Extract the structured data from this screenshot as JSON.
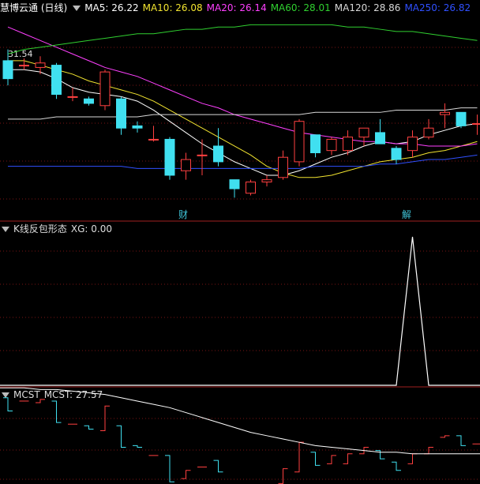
{
  "header": {
    "title": "慧博云通 (日线)",
    "ma": [
      {
        "label": "MA5: 26.22",
        "color": "#ffffff"
      },
      {
        "label": "MA10: 26.08",
        "color": "#f2e430"
      },
      {
        "label": "MA20: 26.14",
        "color": "#ff40ff"
      },
      {
        "label": "MA60: 28.01",
        "color": "#30d030"
      },
      {
        "label": "MA120: 28.86",
        "color": "#d8d8d8"
      },
      {
        "label": "MA250: 26.82",
        "color": "#3050ff"
      }
    ]
  },
  "price_marker": "31.54",
  "event_tags": [
    "财",
    "解"
  ],
  "indicator_panel": {
    "title": "K线反包形态",
    "value_label": "XG: 0.00"
  },
  "mcst_panel": {
    "title": "MCST",
    "value_label": "MCST: 27.57"
  },
  "colors": {
    "up": "#ff4040",
    "down": "#40e0f0",
    "grid": "#7a1515",
    "border": "#a02020"
  },
  "chart_data": [
    {
      "type": "candlestick",
      "title": "慧博云通 (日线)",
      "candles": [
        {
          "o": 31.0,
          "h": 31.5,
          "l": 29.9,
          "c": 30.2
        },
        {
          "o": 30.8,
          "h": 31.1,
          "l": 30.6,
          "c": 30.8
        },
        {
          "o": 30.7,
          "h": 31.2,
          "l": 30.4,
          "c": 30.9
        },
        {
          "o": 30.8,
          "h": 30.9,
          "l": 29.3,
          "c": 29.5
        },
        {
          "o": 29.4,
          "h": 29.8,
          "l": 29.2,
          "c": 29.4
        },
        {
          "o": 29.3,
          "h": 29.4,
          "l": 29.0,
          "c": 29.1
        },
        {
          "o": 29.0,
          "h": 30.6,
          "l": 28.8,
          "c": 30.5
        },
        {
          "o": 29.3,
          "h": 29.4,
          "l": 27.7,
          "c": 28.0
        },
        {
          "o": 28.1,
          "h": 28.3,
          "l": 27.8,
          "c": 28.0
        },
        {
          "o": 27.5,
          "h": 28.1,
          "l": 27.4,
          "c": 27.5
        },
        {
          "o": 27.5,
          "h": 27.6,
          "l": 25.7,
          "c": 25.9
        },
        {
          "o": 26.1,
          "h": 26.9,
          "l": 25.7,
          "c": 26.6
        },
        {
          "o": 26.8,
          "h": 27.5,
          "l": 25.9,
          "c": 26.8
        },
        {
          "o": 27.2,
          "h": 28.0,
          "l": 26.3,
          "c": 26.5
        },
        {
          "o": 25.7,
          "h": 25.7,
          "l": 24.9,
          "c": 25.3
        },
        {
          "o": 25.1,
          "h": 25.7,
          "l": 25.0,
          "c": 25.6
        },
        {
          "o": 25.6,
          "h": 25.9,
          "l": 25.4,
          "c": 25.7
        },
        {
          "o": 25.8,
          "h": 27.0,
          "l": 25.7,
          "c": 26.7
        },
        {
          "o": 26.5,
          "h": 28.4,
          "l": 26.3,
          "c": 28.3
        },
        {
          "o": 27.7,
          "h": 27.7,
          "l": 26.7,
          "c": 26.9
        },
        {
          "o": 27.0,
          "h": 27.6,
          "l": 26.8,
          "c": 27.5
        },
        {
          "o": 27.0,
          "h": 27.9,
          "l": 26.8,
          "c": 27.6
        },
        {
          "o": 27.6,
          "h": 28.0,
          "l": 27.2,
          "c": 28.0
        },
        {
          "o": 27.8,
          "h": 28.4,
          "l": 27.4,
          "c": 27.3
        },
        {
          "o": 27.1,
          "h": 27.2,
          "l": 26.4,
          "c": 26.6
        },
        {
          "o": 27.0,
          "h": 27.9,
          "l": 26.7,
          "c": 27.6
        },
        {
          "o": 27.6,
          "h": 28.4,
          "l": 27.5,
          "c": 28.0
        },
        {
          "o": 28.6,
          "h": 29.1,
          "l": 28.0,
          "c": 28.7
        },
        {
          "o": 28.7,
          "h": 28.7,
          "l": 28.0,
          "c": 28.1
        },
        {
          "o": 28.2,
          "h": 28.6,
          "l": 27.7,
          "c": 28.2
        }
      ],
      "ma": {
        "MA5": [
          30.6,
          30.6,
          30.5,
          30.2,
          29.8,
          29.6,
          29.5,
          29.4,
          29.2,
          28.8,
          28.3,
          27.8,
          27.3,
          26.9,
          26.5,
          26.2,
          25.9,
          25.9,
          26.1,
          26.4,
          26.7,
          26.9,
          27.2,
          27.4,
          27.3,
          27.4,
          27.7,
          27.9,
          28.1,
          28.2
        ],
        "MA10": [
          31.0,
          31.0,
          30.8,
          30.6,
          30.4,
          30.1,
          29.9,
          29.7,
          29.5,
          29.2,
          28.8,
          28.4,
          28.0,
          27.6,
          27.2,
          26.8,
          26.3,
          26.0,
          25.8,
          25.8,
          25.9,
          26.1,
          26.3,
          26.5,
          26.6,
          26.7,
          26.9,
          27.0,
          27.2,
          27.4
        ],
        "MA20": [
          32.5,
          32.2,
          31.9,
          31.6,
          31.3,
          31.0,
          30.7,
          30.5,
          30.3,
          30.0,
          29.7,
          29.4,
          29.1,
          28.9,
          28.6,
          28.4,
          28.2,
          28.0,
          27.8,
          27.7,
          27.6,
          27.5,
          27.4,
          27.4,
          27.3,
          27.3,
          27.2,
          27.2,
          27.2,
          27.3
        ],
        "MA60": [
          31.3,
          31.5,
          31.6,
          31.7,
          31.8,
          31.9,
          32.0,
          32.1,
          32.2,
          32.2,
          32.3,
          32.4,
          32.4,
          32.5,
          32.5,
          32.6,
          32.6,
          32.6,
          32.6,
          32.6,
          32.6,
          32.5,
          32.5,
          32.4,
          32.3,
          32.3,
          32.2,
          32.1,
          32.0,
          31.9
        ],
        "MA120": [
          28.4,
          28.4,
          28.4,
          28.5,
          28.5,
          28.5,
          28.5,
          28.5,
          28.5,
          28.6,
          28.6,
          28.6,
          28.6,
          28.6,
          28.6,
          28.6,
          28.6,
          28.6,
          28.6,
          28.7,
          28.7,
          28.7,
          28.7,
          28.7,
          28.8,
          28.8,
          28.8,
          28.8,
          28.9,
          28.9
        ],
        "MA250": [
          26.3,
          26.3,
          26.3,
          26.3,
          26.3,
          26.3,
          26.3,
          26.3,
          26.2,
          26.2,
          26.2,
          26.2,
          26.2,
          26.2,
          26.2,
          26.2,
          26.2,
          26.2,
          26.2,
          26.3,
          26.3,
          26.3,
          26.3,
          26.4,
          26.4,
          26.5,
          26.6,
          26.6,
          26.7,
          26.8
        ]
      },
      "ylim": [
        24,
        33
      ]
    },
    {
      "type": "line",
      "title": "K线反包形态",
      "series": [
        {
          "name": "XG",
          "values": [
            0,
            0,
            0,
            0,
            0,
            0,
            0,
            0,
            0,
            0,
            0,
            0,
            0,
            0,
            0,
            0,
            0,
            0,
            0,
            0,
            0,
            0,
            0,
            0,
            0,
            1,
            0,
            0,
            0,
            0
          ]
        }
      ],
      "ylim": [
        0,
        1
      ]
    },
    {
      "type": "line",
      "title": "MCST",
      "series": [
        {
          "name": "MCST",
          "values": [
            31.6,
            31.6,
            31.5,
            31.5,
            31.4,
            31.3,
            31.2,
            31.0,
            30.8,
            30.6,
            30.4,
            30.1,
            29.8,
            29.5,
            29.2,
            28.9,
            28.7,
            28.5,
            28.3,
            28.1,
            28.0,
            27.9,
            27.8,
            27.7,
            27.7,
            27.6,
            27.6,
            27.6,
            27.6,
            27.6
          ]
        }
      ],
      "ylim": [
        24,
        33
      ]
    }
  ]
}
